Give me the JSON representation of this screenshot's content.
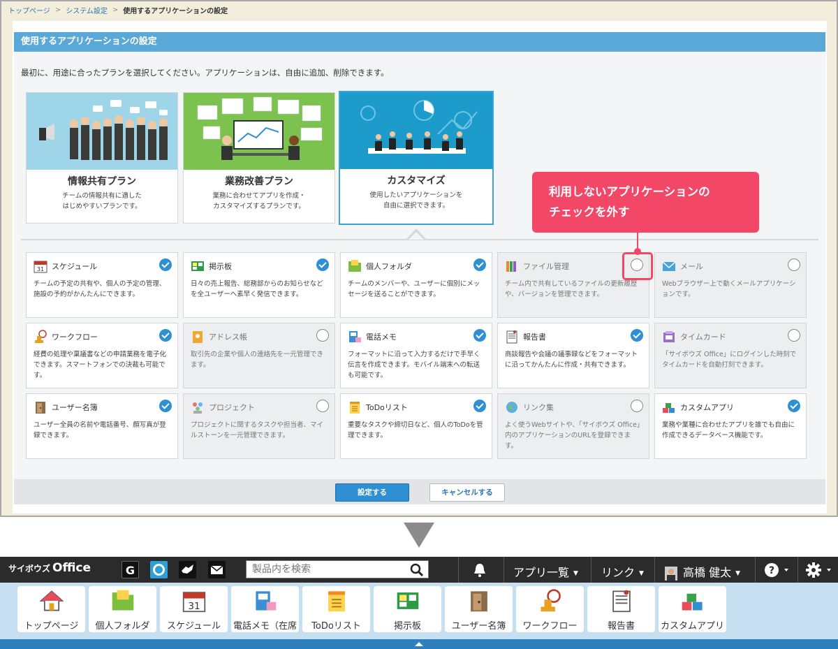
{
  "breadcrumb": {
    "home": "トップページ",
    "system": "システム設定",
    "current": "使用するアプリケーションの設定"
  },
  "panel": {
    "title": "使用するアプリケーションの設定",
    "intro": "最初に、用途に合ったプランを選択してください。アプリケーションは、自由に追加、削除できます。"
  },
  "plans": [
    {
      "name": "情報共有プラン",
      "desc": "チームの情報共有に適した\nはじめやすいプランです。"
    },
    {
      "name": "業務改善プラン",
      "desc": "業務に合わせてアプリを作成・\nカスタマイズするプランです。"
    },
    {
      "name": "カスタマイズ",
      "desc": "使用したいアプリケーションを\n自由に選択できます。"
    }
  ],
  "apps": [
    {
      "name": "スケジュール",
      "desc": "チームの予定の共有や、個人の予定の管理、施設の予約がかんたんにできます。",
      "checked": true,
      "icon": "calendar-icon"
    },
    {
      "name": "掲示板",
      "desc": "日々の売上報告、総務部からのお知らせなどを全ユーザーへ素早く発信できます。",
      "checked": true,
      "icon": "bulletin-board-icon"
    },
    {
      "name": "個人フォルダ",
      "desc": "チームのメンバーや、ユーザーに個別にメッセージを送ることができます。",
      "checked": true,
      "icon": "folder-icon"
    },
    {
      "name": "ファイル管理",
      "desc": "チーム内で共有しているファイルの更新履歴や、バージョンを管理できます。",
      "checked": false,
      "icon": "file-binders-icon"
    },
    {
      "name": "メール",
      "desc": "Webブラウザー上で動くメールアプリケーションです。",
      "checked": false,
      "icon": "mail-icon"
    },
    {
      "name": "ワークフロー",
      "desc": "経費の処理や稟議書などの申請業務を電子化できます。スマートフォンでの決裁も可能です。",
      "checked": true,
      "icon": "stamp-icon"
    },
    {
      "name": "アドレス帳",
      "desc": "取引先の企業や個人の連絡先を一元管理できます。",
      "checked": false,
      "icon": "address-book-icon"
    },
    {
      "name": "電話メモ",
      "desc": "フォーマットに沿って入力するだけで手早く伝言を作成できます。モバイル端末への転送も可能です。",
      "checked": true,
      "icon": "phone-icon"
    },
    {
      "name": "報告書",
      "desc": "商談報告や会議の議事録などをフォーマットに沿ってかんたんに作成・共有できます。",
      "checked": true,
      "icon": "report-icon"
    },
    {
      "name": "タイムカード",
      "desc": "「サイボウズ Office」にログインした時刻でタイムカードを自動打刻できます。",
      "checked": false,
      "icon": "timecard-icon"
    },
    {
      "name": "ユーザー名簿",
      "desc": "ユーザー全員の名前や電話番号、顔写真が登録できます。",
      "checked": true,
      "icon": "door-icon"
    },
    {
      "name": "プロジェクト",
      "desc": "プロジェクトに関するタスクや担当者、マイルストーンを一元管理できます。",
      "checked": false,
      "icon": "project-people-icon"
    },
    {
      "name": "ToDoリスト",
      "desc": "重要なタスクや締切日など、個人のToDoを管理できます。",
      "checked": true,
      "icon": "todo-icon"
    },
    {
      "name": "リンク集",
      "desc": "よく使うWebサイトや、「サイボウズ Office」内のアプリケーションのURLを登録できます。",
      "checked": false,
      "icon": "globe-link-icon"
    },
    {
      "name": "カスタムアプリ",
      "desc": "業務や業種に合わせたアプリを誰でも自由に作成できるデータベース機能です。",
      "checked": true,
      "icon": "blocks-icon"
    }
  ],
  "buttons": {
    "set": "設定する",
    "cancel": "キャンセルする"
  },
  "callout": {
    "text": "利用しないアプリケーションの\nチェックを外す"
  },
  "topbar": {
    "logo_small": "サイボウズ",
    "logo_big": "Office",
    "search_placeholder": "製品内を検索",
    "menu_apps": "アプリ一覧",
    "menu_links": "リンク",
    "user": "高橋 健太",
    "icon_g": "G"
  },
  "appbar": [
    {
      "label": "トップページ",
      "icon": "house-icon"
    },
    {
      "label": "個人フォルダ",
      "icon": "folder-icon"
    },
    {
      "label": "スケジュール",
      "icon": "calendar-icon"
    },
    {
      "label": "電話メモ（在席",
      "icon": "phone-icon"
    },
    {
      "label": "ToDoリスト",
      "icon": "todo-icon"
    },
    {
      "label": "掲示板",
      "icon": "bulletin-board-icon"
    },
    {
      "label": "ユーザー名簿",
      "icon": "door-icon"
    },
    {
      "label": "ワークフロー",
      "icon": "stamp-icon"
    },
    {
      "label": "報告書",
      "icon": "report-icon"
    },
    {
      "label": "カスタムアプリ",
      "icon": "blocks-icon"
    }
  ],
  "colors": {
    "accent": "#2e8fd3",
    "title_bar": "#5aa8d8",
    "callout": "#f24766",
    "topbar": "#2b2b2b",
    "appbar": "#c6e0f1"
  }
}
